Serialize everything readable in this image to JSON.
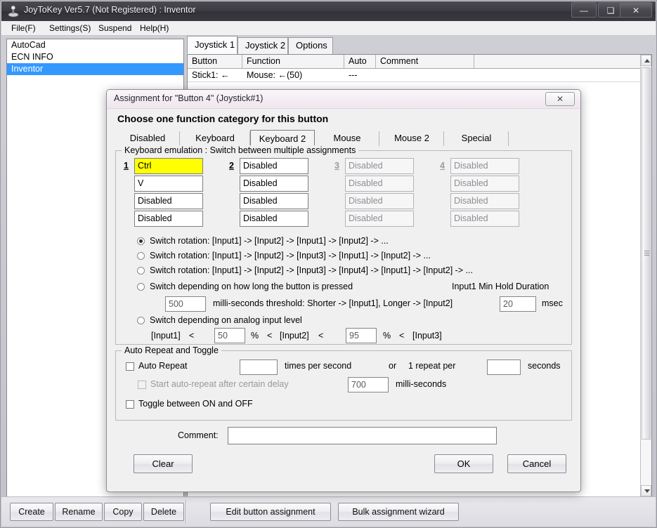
{
  "window": {
    "title": "JoyToKey Ver5.7 (Not Registered) : Inventor",
    "icon": "joystick-icon",
    "controls": {
      "minimize": "—",
      "maximize": "❑",
      "close": "✕"
    }
  },
  "menubar": {
    "items": [
      {
        "label": "File(F)"
      },
      {
        "label": "Settings(S)"
      },
      {
        "label": "Suspend"
      },
      {
        "label": "Help(H)"
      }
    ]
  },
  "profiles": {
    "items": [
      {
        "label": "AutoCad",
        "selected": false
      },
      {
        "label": "ECN INFO",
        "selected": false
      },
      {
        "label": "Inventor",
        "selected": true
      }
    ]
  },
  "joystick_tabs": [
    {
      "label": "Joystick 1",
      "active": true
    },
    {
      "label": "Joystick 2",
      "active": false
    },
    {
      "label": "Options",
      "active": false
    }
  ],
  "assignment_table": {
    "columns": [
      "Button",
      "Function",
      "Auto",
      "Comment",
      ""
    ],
    "rows": [
      {
        "button": "Stick1: ←",
        "function": "Mouse: ←(50)",
        "auto": "---",
        "comment": ""
      }
    ]
  },
  "toolbar": {
    "buttons": [
      {
        "label": "Create"
      },
      {
        "label": "Rename"
      },
      {
        "label": "Copy"
      },
      {
        "label": "Delete"
      },
      {
        "label": "Edit button assignment"
      },
      {
        "label": "Bulk assignment wizard"
      }
    ]
  },
  "dialog": {
    "title": "Assignment for \"Button 4\" (Joystick#1)",
    "close_icon": "✕",
    "heading": "Choose one function category for this button",
    "category_tabs": [
      {
        "label": "Disabled",
        "active": false
      },
      {
        "label": "Keyboard",
        "active": false
      },
      {
        "label": "Keyboard 2",
        "active": true
      },
      {
        "label": "Mouse",
        "active": false
      },
      {
        "label": "Mouse 2",
        "active": false
      },
      {
        "label": "Special",
        "active": false
      }
    ],
    "keyboard_group": {
      "legend": "Keyboard emulation : Switch between multiple assignments",
      "columns": [
        {
          "number": "1",
          "enabled": true,
          "fields": [
            {
              "value": "Ctrl",
              "highlighted": true
            },
            {
              "value": "V",
              "highlighted": false
            },
            {
              "value": "Disabled",
              "highlighted": false
            },
            {
              "value": "Disabled",
              "highlighted": false
            }
          ]
        },
        {
          "number": "2",
          "enabled": true,
          "fields": [
            {
              "value": "Disabled",
              "highlighted": false
            },
            {
              "value": "Disabled",
              "highlighted": false
            },
            {
              "value": "Disabled",
              "highlighted": false
            },
            {
              "value": "Disabled",
              "highlighted": false
            }
          ]
        },
        {
          "number": "3",
          "enabled": false,
          "fields": [
            {
              "value": "Disabled",
              "highlighted": false
            },
            {
              "value": "Disabled",
              "highlighted": false
            },
            {
              "value": "Disabled",
              "highlighted": false
            },
            {
              "value": "Disabled",
              "highlighted": false
            }
          ]
        },
        {
          "number": "4",
          "enabled": false,
          "fields": [
            {
              "value": "Disabled",
              "highlighted": false
            },
            {
              "value": "Disabled",
              "highlighted": false
            },
            {
              "value": "Disabled",
              "highlighted": false
            },
            {
              "value": "Disabled",
              "highlighted": false
            }
          ]
        }
      ],
      "radios": [
        {
          "label": "Switch rotation: [Input1] -> [Input2] -> [Input1] -> [Input2] -> ...",
          "checked": true
        },
        {
          "label": "Switch rotation: [Input1] -> [Input2] -> [Input3] -> [Input1] -> [Input2] -> ...",
          "checked": false
        },
        {
          "label": "Switch rotation: [Input1] -> [Input2] -> [Input3] -> [Input4] -> [Input1] -> [Input2] -> ...",
          "checked": false
        },
        {
          "label": "Switch depending on how long the button is pressed",
          "checked": false
        },
        {
          "label": "Switch depending on analog input level",
          "checked": false
        }
      ],
      "hold": {
        "threshold_value": "500",
        "threshold_text": "milli-seconds threshold: Shorter -> [Input1], Longer -> [Input2]",
        "min_hold_label": "Input1 Min Hold Duration",
        "min_hold_value": "20",
        "min_hold_unit": "msec"
      },
      "analog": {
        "input1_label": "[Input1]",
        "lt1": "<",
        "value1": "50",
        "pct1": "%",
        "lt2": "<",
        "input2_label": "[Input2]",
        "lt3": "<",
        "value2": "95",
        "pct2": "%",
        "lt4": "<",
        "input3_label": "[Input3]"
      }
    },
    "auto_repeat_group": {
      "legend": "Auto Repeat and Toggle",
      "auto_repeat": {
        "label": "Auto Repeat",
        "checked": false,
        "value": ""
      },
      "times_per_second": "times per second",
      "or": "or",
      "one_repeat_per": "1 repeat per",
      "seconds_value": "",
      "seconds_label": "seconds",
      "delay": {
        "label": "Start auto-repeat after certain delay",
        "checked": false,
        "enabled": false
      },
      "delay_value": "700",
      "delay_unit": "milli-seconds",
      "toggle": {
        "label": "Toggle between ON and OFF",
        "checked": false
      }
    },
    "comment": {
      "label": "Comment:",
      "value": ""
    },
    "buttons": {
      "clear": "Clear",
      "ok": "OK",
      "cancel": "Cancel"
    }
  }
}
